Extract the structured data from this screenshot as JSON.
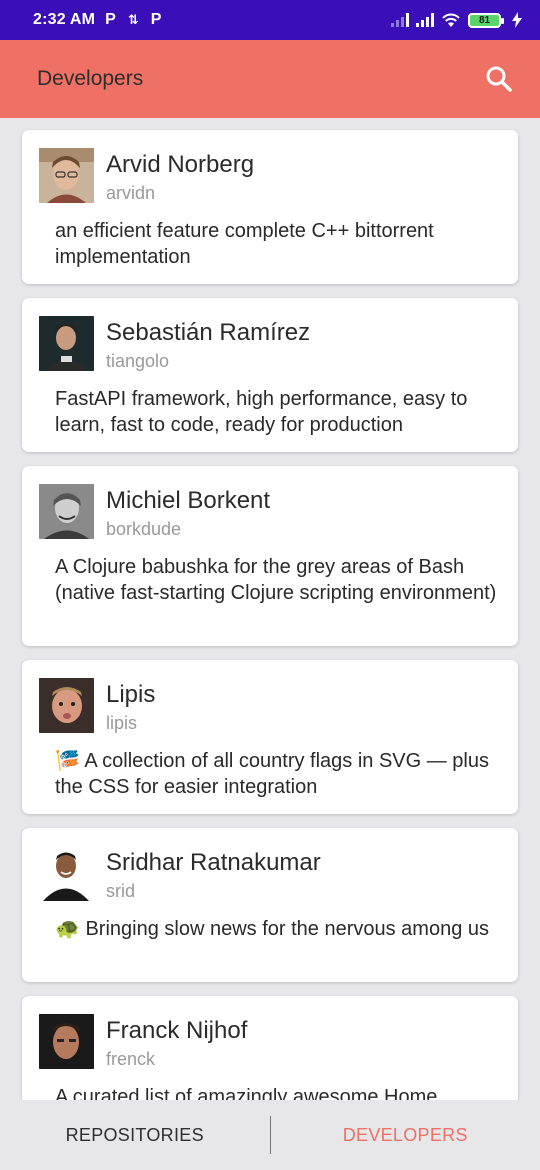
{
  "status_bar": {
    "time": "2:32 AM",
    "left_icons": [
      "P",
      "⇅",
      "P"
    ],
    "battery": "81"
  },
  "app_bar": {
    "title": "Developers",
    "search_icon": "search-icon",
    "color": "#ef7065"
  },
  "developers": [
    {
      "name": "Arvid Norberg",
      "username": "arvidn",
      "description": "an efficient feature complete C++ bittorrent implementation"
    },
    {
      "name": "Sebastián Ramírez",
      "username": "tiangolo",
      "description": "FastAPI framework, high performance, easy to learn, fast to code, ready for production"
    },
    {
      "name": "Michiel Borkent",
      "username": "borkdude",
      "description": "A Clojure babushka for the grey areas of Bash (native fast-starting Clojure scripting environment)"
    },
    {
      "name": "Lipis",
      "username": "lipis",
      "description": "🎏 A collection of all country flags in SVG — plus the CSS for easier integration"
    },
    {
      "name": "Sridhar Ratnakumar",
      "username": "srid",
      "description": "🐢 Bringing slow news for the nervous among us"
    },
    {
      "name": "Franck Nijhof",
      "username": "frenck",
      "description": "A curated list of amazingly awesome Home"
    }
  ],
  "bottom_nav": {
    "repositories": "REPOSITORIES",
    "developers": "DEVELOPERS",
    "active": "developers"
  }
}
